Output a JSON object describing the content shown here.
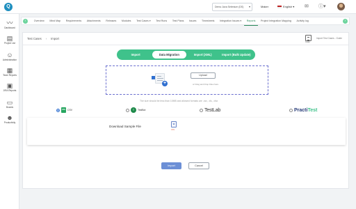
{
  "topbar": {
    "logo": "Q",
    "project": "Demo Java Selenium (DS)",
    "role": "Maker",
    "language": "English",
    "icons": [
      "mail-icon",
      "help-icon",
      "avatar"
    ]
  },
  "sidebar": {
    "items": [
      {
        "label": "Dashboard",
        "icon": "chart-line-icon",
        "glyph": "〰"
      },
      {
        "label": "Project List",
        "icon": "clipboard-icon",
        "glyph": "▤"
      },
      {
        "label": "Administration",
        "icon": "people-icon",
        "glyph": "☺"
      },
      {
        "label": "Team Reports",
        "icon": "report-icon",
        "glyph": "▦"
      },
      {
        "label": "JIRA Reports",
        "icon": "jira-icon",
        "glyph": "▣"
      },
      {
        "label": "Boards",
        "icon": "monitor-icon",
        "glyph": "▭"
      },
      {
        "label": "Productivity",
        "icon": "productivity-icon",
        "glyph": "☻"
      }
    ]
  },
  "nav": {
    "items": [
      "Overview",
      "Mind Map",
      "Requirements",
      "Attachments",
      "Releases",
      "Modules",
      "Test Cases ▾",
      "Test Runs",
      "Test Plans",
      "Issues",
      "Timesheets",
      "Integration Issues ▾",
      "Reports",
      "Project Integration Mapping",
      "Activity log"
    ],
    "active_index": 12
  },
  "breadcrumb": {
    "parent": "Test Cases",
    "current": "Import"
  },
  "import_guide": {
    "label": "Guide",
    "text": "Import Test Cases - Guide"
  },
  "tabs": [
    "Import",
    "Data Migration",
    "Import (XML)",
    "Import (Bulk Update)"
  ],
  "tabs_active_index": 1,
  "dropzone": {
    "upload_label": "Upload",
    "hint": "or Drag and Drop Files here"
  },
  "size_note": "The size should be less than 10MB and allowed formats are .csv, .xls, .xlsx",
  "sources": {
    "csv": {
      "label": "CSV",
      "icon_text": "CSV",
      "selected": true
    },
    "testbot": {
      "label": "TestBot",
      "icon_text": "T",
      "selected": false
    },
    "testlab": {
      "label": "TestLab",
      "selected": false
    },
    "practitest": {
      "label_a": "Practi",
      "label_b": "Test",
      "selected": false
    }
  },
  "download": {
    "label": "Download Sample File",
    "icon_text": "W",
    "caption": "CSV"
  },
  "buttons": {
    "import": "Import",
    "cancel": "Cancel"
  }
}
